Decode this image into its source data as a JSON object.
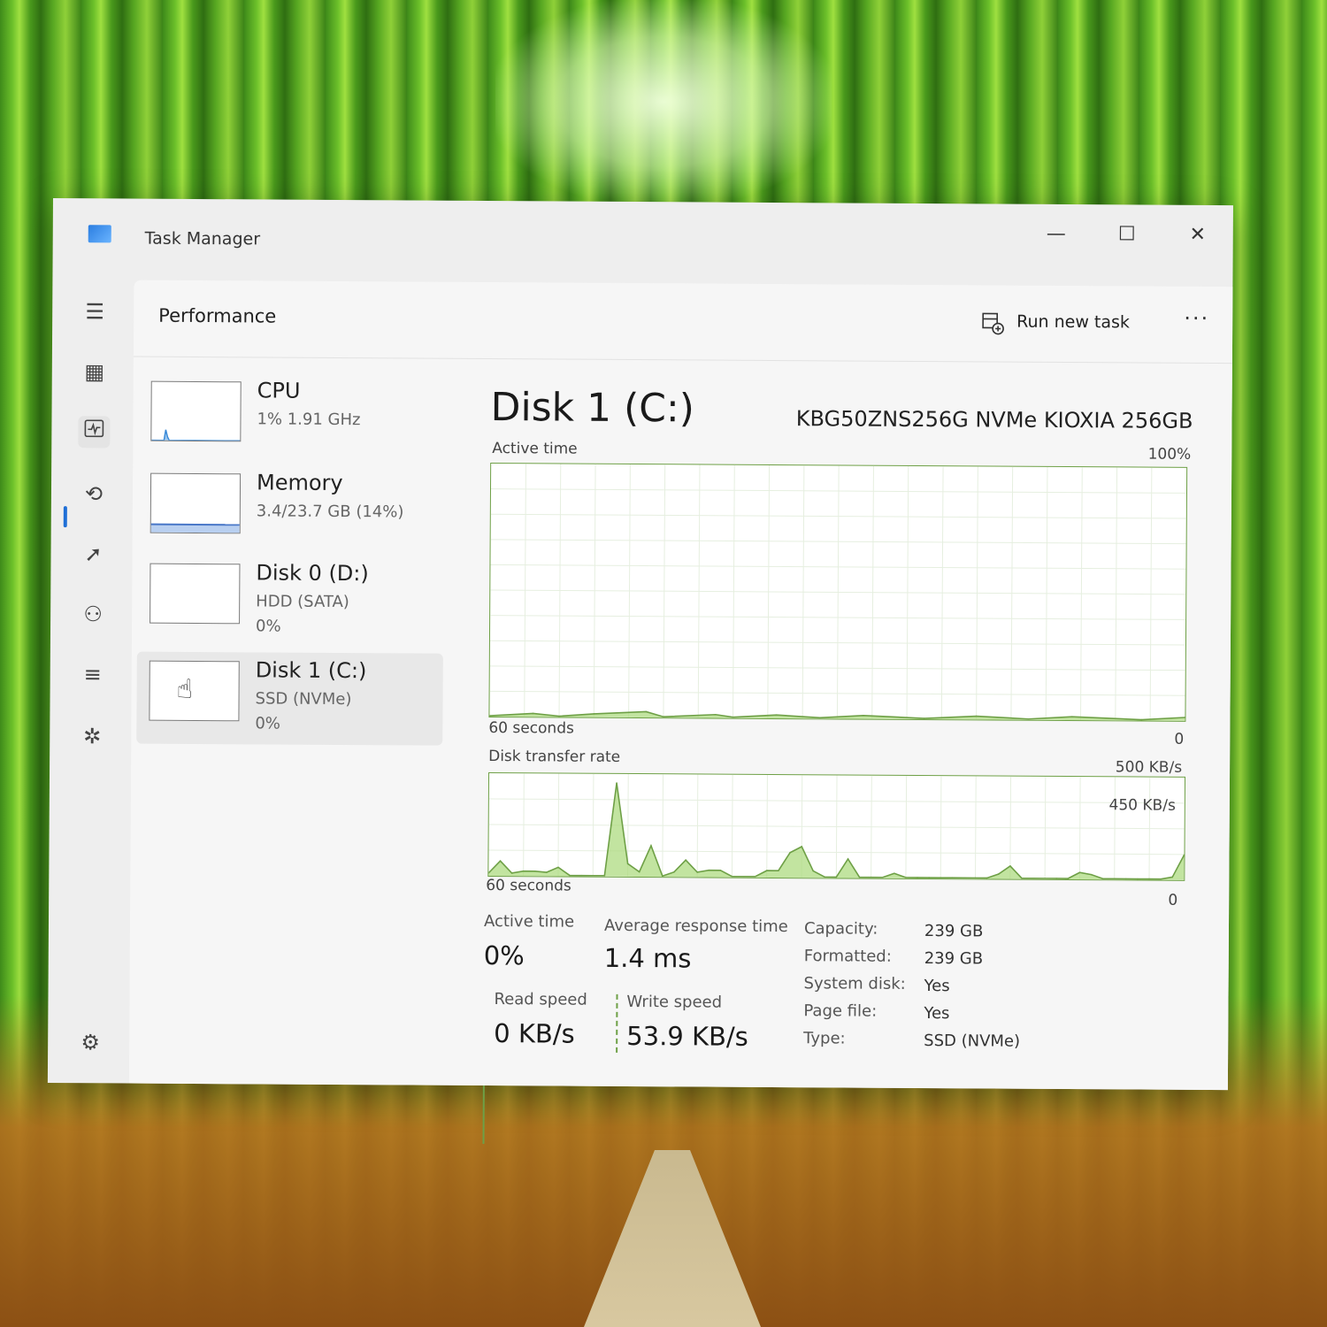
{
  "app": {
    "title": "Task Manager"
  },
  "window_controls": {
    "minimize": "—",
    "maximize": "☐",
    "close": "✕"
  },
  "header": {
    "page_title": "Performance",
    "run_new_task": "Run new task",
    "more": "···"
  },
  "devices": [
    {
      "name": "CPU",
      "sub": "1% 1.91 GHz",
      "sub2": ""
    },
    {
      "name": "Memory",
      "sub": "3.4/23.7 GB (14%)",
      "sub2": ""
    },
    {
      "name": "Disk 0 (D:)",
      "sub": "HDD (SATA)",
      "sub2": "0%"
    },
    {
      "name": "Disk 1 (C:)",
      "sub": "SSD (NVMe)",
      "sub2": "0%"
    }
  ],
  "detail": {
    "title": "Disk 1 (C:)",
    "model": "KBG50ZNS256G NVMe KIOXIA 256GB",
    "active_graph": {
      "label": "Active time",
      "max": "100%",
      "time": "60 seconds",
      "min": "0"
    },
    "transfer_graph": {
      "label": "Disk transfer rate",
      "max": "500 KB/s",
      "mark": "450 KB/s",
      "time": "60 seconds",
      "min": "0"
    },
    "stats": {
      "active_time_label": "Active time",
      "active_time": "0%",
      "avg_response_label": "Average response time",
      "avg_response": "1.4 ms",
      "read_label": "Read speed",
      "read": "0 KB/s",
      "write_label": "Write speed",
      "write": "53.9 KB/s"
    },
    "props": [
      {
        "label": "Capacity:",
        "value": "239 GB"
      },
      {
        "label": "Formatted:",
        "value": "239 GB"
      },
      {
        "label": "System disk:",
        "value": "Yes"
      },
      {
        "label": "Page file:",
        "value": "Yes"
      },
      {
        "label": "Type:",
        "value": "SSD (NVMe)"
      }
    ]
  },
  "colors": {
    "accent": "#1f6fd6",
    "disk_line": "#6ea046",
    "disk_fill": "#a8d878"
  },
  "icons": [
    "hamburger-icon",
    "processes-icon",
    "performance-icon",
    "app-history-icon",
    "startup-icon",
    "users-icon",
    "details-icon",
    "services-icon",
    "settings-icon",
    "run-task-icon",
    "hand-cursor-icon"
  ],
  "chart_data": [
    {
      "type": "area",
      "title": "Active time",
      "xlabel": "60 seconds",
      "ylim": [
        0,
        100
      ],
      "x": [
        0,
        5,
        8,
        12,
        18,
        20,
        26,
        28,
        33,
        38,
        43,
        50,
        56,
        62,
        67,
        75,
        80
      ],
      "values": [
        0,
        1,
        0,
        1,
        2,
        0,
        1,
        0,
        1,
        0,
        1,
        0,
        1,
        0,
        1,
        0,
        1
      ]
    },
    {
      "type": "area",
      "title": "Disk transfer rate",
      "xlabel": "60 seconds",
      "ylim": [
        0,
        500
      ],
      "x": [
        0,
        1,
        2,
        3,
        4,
        5,
        6,
        7,
        8,
        9,
        10,
        11,
        12,
        13,
        14,
        15,
        16,
        17,
        18,
        19,
        20,
        21,
        22,
        23,
        24,
        25,
        26,
        27,
        28,
        29,
        30,
        31,
        32,
        33,
        34,
        35,
        36,
        37,
        38,
        39,
        40,
        41,
        42,
        43,
        44,
        45,
        46,
        47,
        48,
        49,
        50,
        51,
        52,
        53,
        54,
        55,
        56,
        57,
        58,
        59,
        60
      ],
      "values": [
        10,
        70,
        10,
        20,
        20,
        15,
        40,
        0,
        0,
        0,
        0,
        460,
        60,
        20,
        150,
        0,
        20,
        80,
        20,
        30,
        30,
        0,
        0,
        0,
        30,
        30,
        120,
        150,
        30,
        0,
        0,
        90,
        0,
        0,
        0,
        20,
        0,
        0,
        0,
        0,
        0,
        0,
        0,
        0,
        20,
        60,
        0,
        0,
        0,
        0,
        0,
        30,
        20,
        0,
        0,
        0,
        0,
        0,
        0,
        10,
        120
      ]
    }
  ]
}
